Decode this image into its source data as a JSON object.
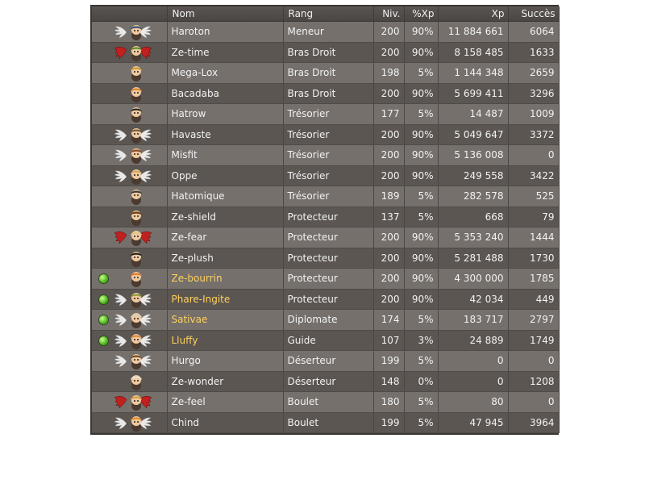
{
  "columns": {
    "name": "Nom",
    "rank": "Rang",
    "level": "Niv.",
    "xp_pct": "%Xp",
    "xp": "Xp",
    "success": "Succès"
  },
  "colors": {
    "angel": "#e9e9e9",
    "demon": "#c0201e",
    "online_name": "#ffd15c",
    "online_dot": "#4db31d"
  },
  "members": [
    {
      "name": "Haroton",
      "rank": "Meneur",
      "level": "200",
      "xp_pct": "90%",
      "xp": "11 884 661",
      "success": "6064",
      "online": false,
      "alignment": "angel",
      "avatar_color": "#2f4f78"
    },
    {
      "name": "Ze-time",
      "rank": "Bras Droit",
      "level": "200",
      "xp_pct": "90%",
      "xp": "8 158 485",
      "success": "1633",
      "online": false,
      "alignment": "demon",
      "avatar_color": "#5a8c2f"
    },
    {
      "name": "Mega-Lox",
      "rank": "Bras Droit",
      "level": "198",
      "xp_pct": "5%",
      "xp": "1 144 348",
      "success": "2659",
      "online": false,
      "alignment": "none",
      "avatar_color": "#c99a2d"
    },
    {
      "name": "Bacadaba",
      "rank": "Bras Droit",
      "level": "200",
      "xp_pct": "90%",
      "xp": "5 699 411",
      "success": "3296",
      "online": false,
      "alignment": "none",
      "avatar_color": "#d8862a"
    },
    {
      "name": "Hatrow",
      "rank": "Trésorier",
      "level": "177",
      "xp_pct": "5%",
      "xp": "14 487",
      "success": "1009",
      "online": false,
      "alignment": "none",
      "avatar_color": "#2a2a2a"
    },
    {
      "name": "Havaste",
      "rank": "Trésorier",
      "level": "200",
      "xp_pct": "90%",
      "xp": "5 049 647",
      "success": "3372",
      "online": false,
      "alignment": "angel",
      "avatar_color": "#7a5a36"
    },
    {
      "name": "Misfit",
      "rank": "Trésorier",
      "level": "200",
      "xp_pct": "90%",
      "xp": "5 136 008",
      "success": "0",
      "online": false,
      "alignment": "angel",
      "avatar_color": "#8a4a2a"
    },
    {
      "name": "Oppe",
      "rank": "Trésorier",
      "level": "200",
      "xp_pct": "90%",
      "xp": "249 558",
      "success": "3422",
      "online": false,
      "alignment": "angel",
      "avatar_color": "#d9a860"
    },
    {
      "name": "Hatomique",
      "rank": "Trésorier",
      "level": "189",
      "xp_pct": "5%",
      "xp": "282 578",
      "success": "525",
      "online": false,
      "alignment": "none",
      "avatar_color": "#3a3a3a"
    },
    {
      "name": "Ze-shield",
      "rank": "Protecteur",
      "level": "137",
      "xp_pct": "5%",
      "xp": "668",
      "success": "79",
      "online": false,
      "alignment": "none",
      "avatar_color": "#6b3a1a"
    },
    {
      "name": "Ze-fear",
      "rank": "Protecteur",
      "level": "200",
      "xp_pct": "90%",
      "xp": "5 353 240",
      "success": "1444",
      "online": false,
      "alignment": "demon",
      "avatar_color": "#e1c98a"
    },
    {
      "name": "Ze-plush",
      "rank": "Protecteur",
      "level": "200",
      "xp_pct": "90%",
      "xp": "5 281 488",
      "success": "1730",
      "online": false,
      "alignment": "none",
      "avatar_color": "#1e1e1e"
    },
    {
      "name": "Ze-bourrin",
      "rank": "Protecteur",
      "level": "200",
      "xp_pct": "90%",
      "xp": "4 300 000",
      "success": "1785",
      "online": true,
      "alignment": "none",
      "avatar_color": "#e07a2b"
    },
    {
      "name": "Phare-Ingite",
      "rank": "Protecteur",
      "level": "200",
      "xp_pct": "90%",
      "xp": "42 034",
      "success": "449",
      "online": true,
      "alignment": "angel",
      "avatar_color": "#8c9a3a"
    },
    {
      "name": "Sativae",
      "rank": "Diplomate",
      "level": "174",
      "xp_pct": "5%",
      "xp": "183 717",
      "success": "2797",
      "online": true,
      "alignment": "angel",
      "avatar_color": "#d8d0b8"
    },
    {
      "name": "Lluffy",
      "rank": "Guide",
      "level": "107",
      "xp_pct": "3%",
      "xp": "24 889",
      "success": "1749",
      "online": true,
      "alignment": "angel",
      "avatar_color": "#d98a3a"
    },
    {
      "name": "Hurgo",
      "rank": "Déserteur",
      "level": "199",
      "xp_pct": "5%",
      "xp": "0",
      "success": "0",
      "online": false,
      "alignment": "angel",
      "avatar_color": "#6a4a2a"
    },
    {
      "name": "Ze-wonder",
      "rank": "Déserteur",
      "level": "148",
      "xp_pct": "0%",
      "xp": "0",
      "success": "1208",
      "online": false,
      "alignment": "none",
      "avatar_color": "#e8e0d0"
    },
    {
      "name": "Ze-feel",
      "rank": "Boulet",
      "level": "180",
      "xp_pct": "5%",
      "xp": "80",
      "success": "0",
      "online": false,
      "alignment": "demon",
      "avatar_color": "#d9a040"
    },
    {
      "name": "Chind",
      "rank": "Boulet",
      "level": "199",
      "xp_pct": "5%",
      "xp": "47 945",
      "success": "3964",
      "online": false,
      "alignment": "angel",
      "avatar_color": "#e08a30"
    }
  ]
}
